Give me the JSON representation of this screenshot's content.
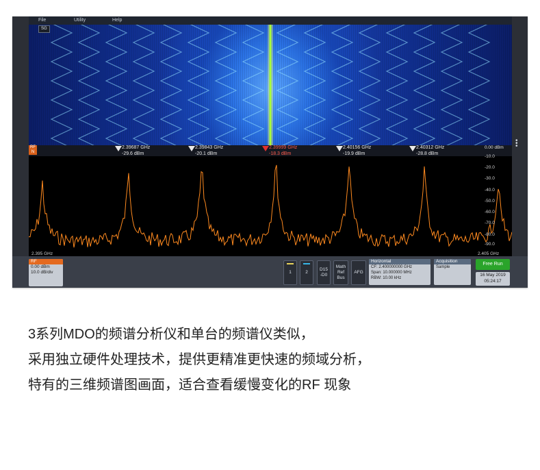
{
  "menu": {
    "file": "File",
    "utility": "Utility",
    "help": "Help"
  },
  "spectrogram_badge": "SG",
  "channel_badge": {
    "line1": "RF",
    "line2": "N"
  },
  "markers": [
    {
      "freq": "2.39687 GHz",
      "amp": "-29.6 dBm",
      "reference": false
    },
    {
      "freq": "2.39843 GHz",
      "amp": "-20.1 dBm",
      "reference": false
    },
    {
      "freq": "2.39999 GHz",
      "amp": "-18.3 dBm",
      "reference": true,
      "glyph": "R"
    },
    {
      "freq": "2.40156 GHz",
      "amp": "-19.9 dBm",
      "reference": false
    },
    {
      "freq": "2.40312 GHz",
      "amp": "-28.8 dBm",
      "reference": false
    }
  ],
  "y_axis": {
    "top_label": "0.00 dBm",
    "ticks": [
      "-10.0",
      "-20.0",
      "-30.0",
      "-40.0",
      "-50.0",
      "-60.0",
      "-70.0",
      "-80.0",
      "-90.0"
    ]
  },
  "x_axis": {
    "start": "2.395 GHz",
    "end": "2.405 GHz"
  },
  "rf_box": {
    "title": "RF",
    "line1": "0.00 dBm",
    "line2": "10.0 dB/div"
  },
  "buttons": {
    "ch1": "1",
    "ch2": "2",
    "d15_line1": "D15",
    "d15_line2": "-D0",
    "math_line1": "Math",
    "math_line2": "Ref",
    "math_line3": "Bus",
    "afg": "AFG"
  },
  "horizontal": {
    "title": "Horizontal",
    "cf": "CF:    2.400000000 GHz",
    "span": "Span: 10.000000 MHz",
    "rbw": "RBW: 10.00 kHz"
  },
  "acquisition": {
    "title": "Acquisition",
    "mode": "Sample"
  },
  "free_run": "Free Run",
  "date": "16 May 2019",
  "time": "05:24:17",
  "caption": [
    "3系列MDO的频谱分析仪和单台的频谱仪类似，",
    "采用独立硬件处理技术，提供更精准更快速的频域分析，",
    "特有的三维频谱图画面，适合查看缓慢变化的RF 现象"
  ],
  "colors": {
    "trace": "#ff8a1f",
    "center_line": "#a8ff3a",
    "rf_orange": "#e46a20",
    "free_run_green": "#2aa42a"
  }
}
